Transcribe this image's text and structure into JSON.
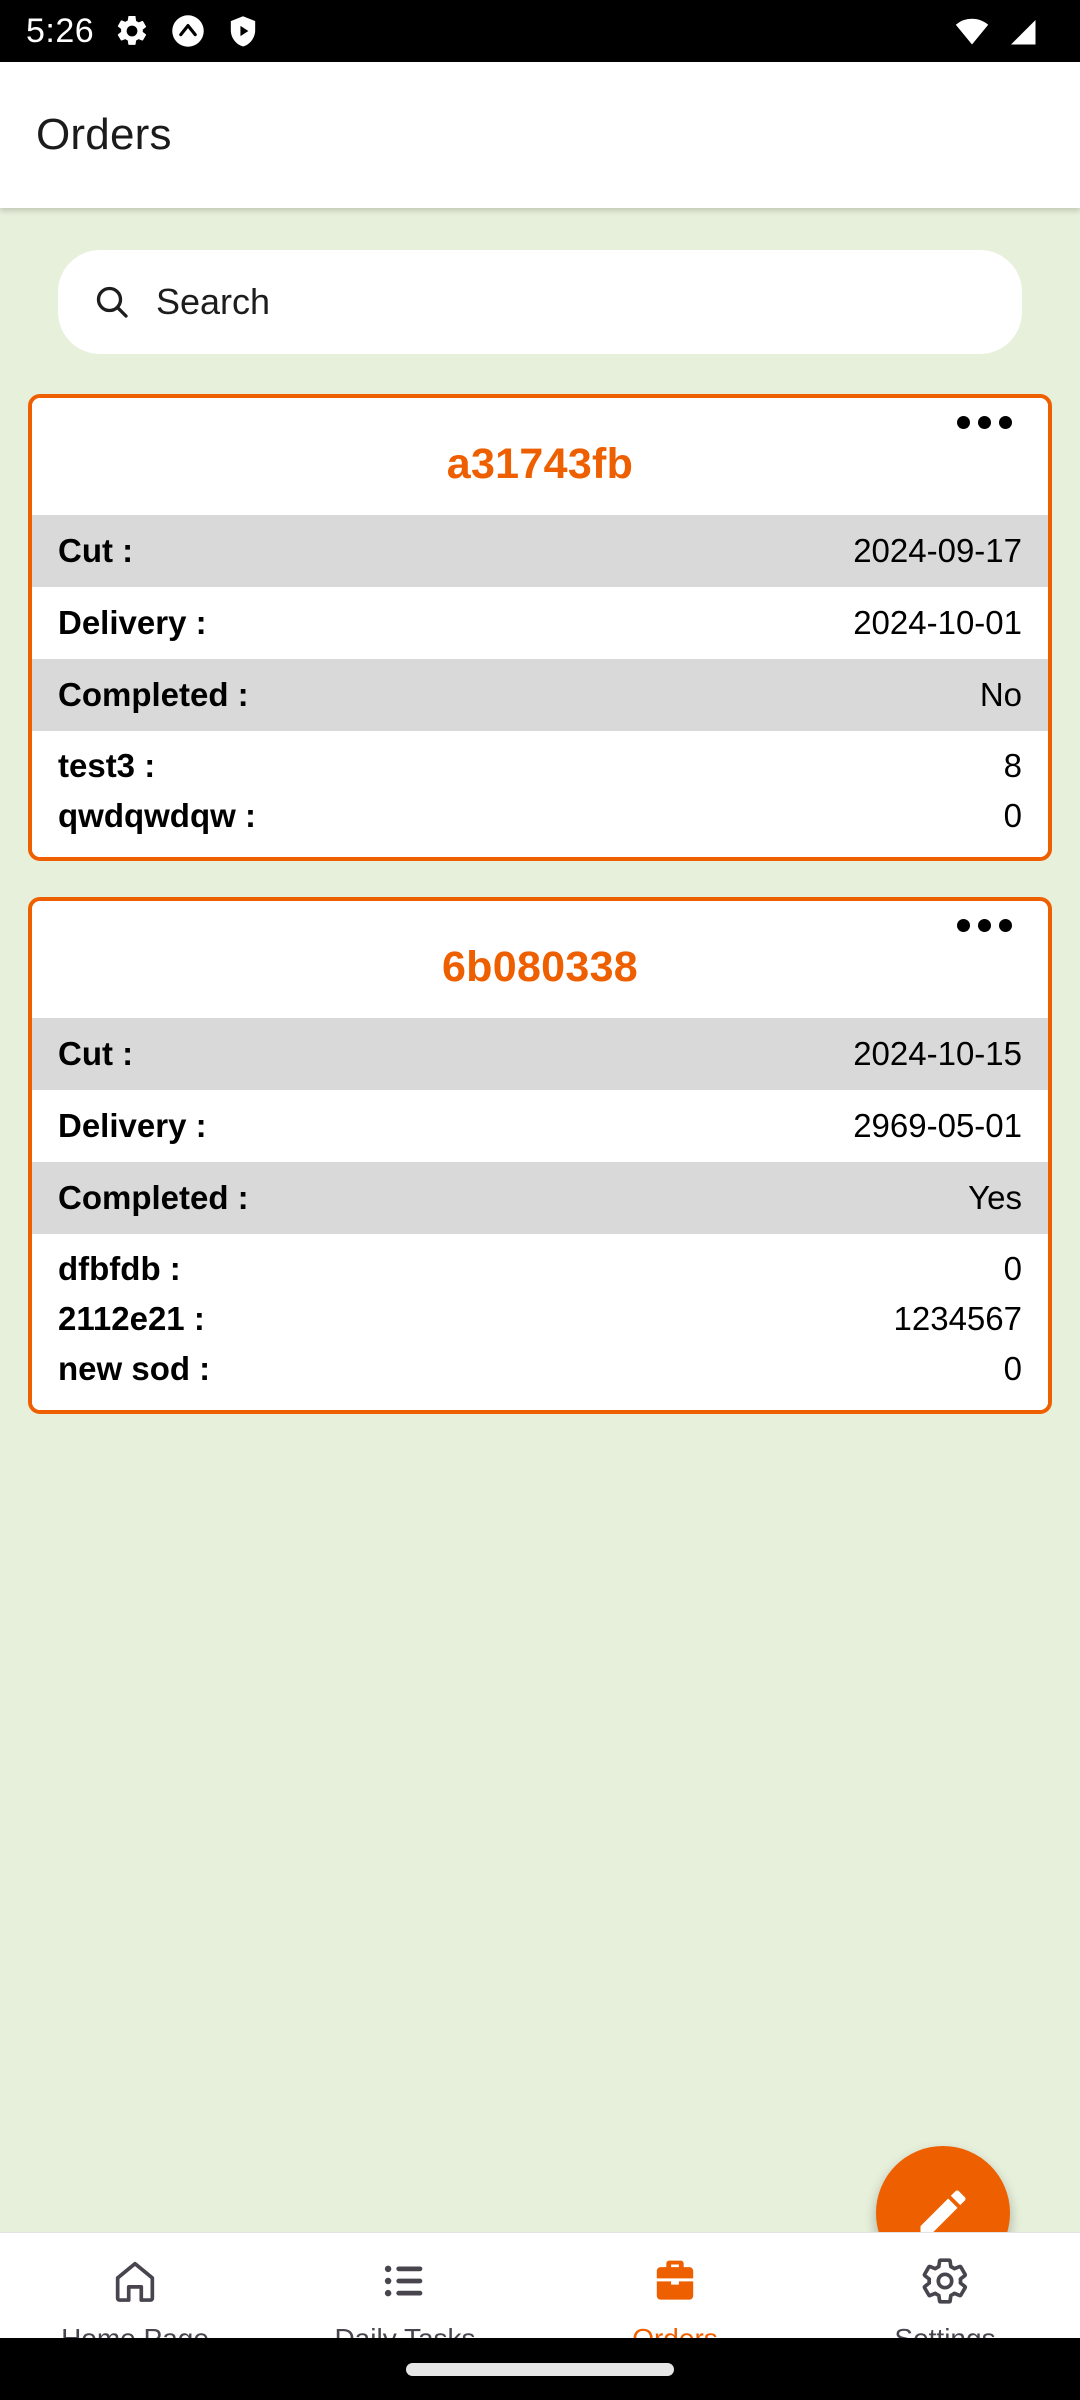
{
  "status_bar": {
    "time": "5:26",
    "left_icons": [
      "gear-icon",
      "circle-chevron-up-icon",
      "shield-play-icon"
    ],
    "right_icons": [
      "wifi-icon",
      "cellular-signal-icon"
    ]
  },
  "app_bar": {
    "title": "Orders"
  },
  "search": {
    "placeholder": "Search",
    "value": "",
    "icon": "search-icon"
  },
  "colors": {
    "accent": "#ee5f00",
    "content_background": "#e7f0db",
    "row_alt": "#d9d9d9",
    "card_background": "#ffffff",
    "nav_inactive": "#49454f"
  },
  "orders": [
    {
      "title": "a31743fb",
      "menu_icon": "more-options-icon",
      "meta": [
        {
          "label": "Cut :",
          "value": "2024-09-17",
          "shaded": true
        },
        {
          "label": "Delivery :",
          "value": "2024-10-01",
          "shaded": false
        },
        {
          "label": "Completed :",
          "value": "No",
          "shaded": true
        }
      ],
      "items": [
        {
          "label": "test3 :",
          "value": "8"
        },
        {
          "label": "qwdqwdqw :",
          "value": "0"
        }
      ]
    },
    {
      "title": "6b080338",
      "menu_icon": "more-options-icon",
      "meta": [
        {
          "label": "Cut :",
          "value": "2024-10-15",
          "shaded": true
        },
        {
          "label": "Delivery :",
          "value": "2969-05-01",
          "shaded": false
        },
        {
          "label": "Completed :",
          "value": "Yes",
          "shaded": true
        }
      ],
      "items": [
        {
          "label": "dfbfdb :",
          "value": "0"
        },
        {
          "label": "2112e21 :",
          "value": "1234567"
        },
        {
          "label": "new sod :",
          "value": "0"
        }
      ]
    }
  ],
  "fab": {
    "icon": "edit-pencil-icon",
    "label": ""
  },
  "bottom_nav": {
    "items": [
      {
        "label": "Home Page",
        "icon": "home-icon",
        "active": false
      },
      {
        "label": "Daily Tasks",
        "icon": "list-icon",
        "active": false
      },
      {
        "label": "Orders",
        "icon": "briefcase-icon",
        "active": true
      },
      {
        "label": "Settings",
        "icon": "gear-icon",
        "active": false
      }
    ]
  }
}
